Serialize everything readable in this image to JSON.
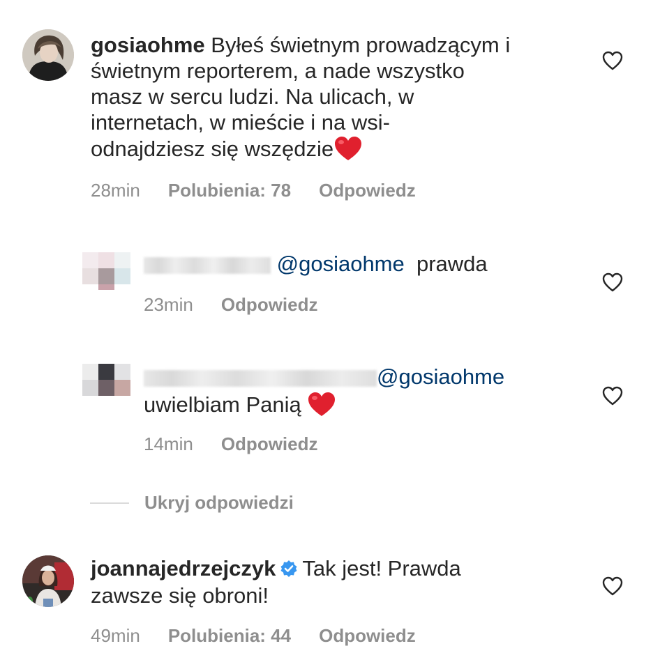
{
  "comments": [
    {
      "username": "gosiaohme",
      "text_lines": [
        "Byłeś świetnym prowadzącym i",
        "świetnym reporterem, a nade wszystko",
        "masz w sercu ludzi. Na ulicach, w",
        "internetach, w mieście i na wsi-",
        "odnajdziesz się wszędzie"
      ],
      "time": "28min",
      "likes": "Polubienia: 78",
      "reply": "Odpowiedz",
      "emoji": "❤️"
    },
    {
      "username": "",
      "mention": "@gosiaohme",
      "text": "prawda",
      "time": "23min",
      "reply": "Odpowiedz"
    },
    {
      "username": "",
      "mention": "@gosiaohme",
      "text": "uwielbiam Panią",
      "time": "14min",
      "reply": "Odpowiedz",
      "emoji": "❤️"
    },
    {
      "username": "joannajedrzejczyk",
      "verified": true,
      "text_lines": [
        "Tak jest! Prawda",
        "zawsze się obroni!"
      ],
      "time": "49min",
      "likes": "Polubienia: 44",
      "reply": "Odpowiedz"
    }
  ],
  "hide_replies": "Ukryj odpowiedzi",
  "colors": {
    "text": "#262626",
    "meta": "#8e8e8e",
    "mention": "#00376b",
    "heart": "#e0202e",
    "verified": "#3897f0"
  },
  "icons": {
    "like": "heart-outline-icon",
    "verified": "verified-badge-icon",
    "emoji": "red-heart-emoji"
  }
}
